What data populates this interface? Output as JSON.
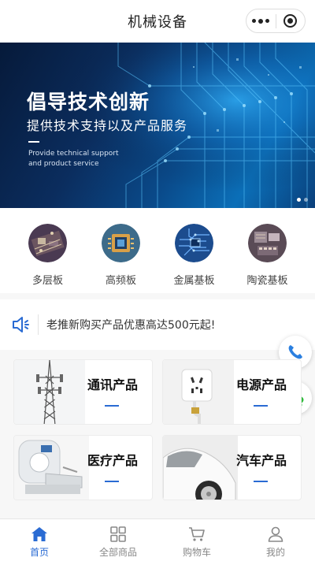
{
  "header": {
    "title": "机械设备",
    "more_icon": "more-dots-icon",
    "close_icon": "target-close-icon"
  },
  "banner": {
    "headline": "倡导技术创新",
    "subheadline": "提供技术支持以及产品服务",
    "english_line1": "Provide technical support",
    "english_line2": "and product service",
    "slide_count": 2,
    "active_slide": 1
  },
  "categories": [
    {
      "label": "多层板",
      "icon": "pcb-multilayer-icon"
    },
    {
      "label": "高频板",
      "icon": "pcb-chip-icon"
    },
    {
      "label": "金属基板",
      "icon": "pcb-metal-icon"
    },
    {
      "label": "陶瓷基板",
      "icon": "pcb-ceramic-icon"
    }
  ],
  "notice": {
    "icon": "speaker-icon",
    "text": "老推新购买产品优惠高达500元起!"
  },
  "floating": {
    "phone_icon": "phone-icon",
    "wechat_icon": "wechat-icon"
  },
  "products": [
    {
      "name": "通讯产品"
    },
    {
      "name": "电源产品"
    },
    {
      "name": "医疗产品"
    },
    {
      "name": "汽车产品"
    }
  ],
  "tabbar": {
    "items": [
      {
        "label": "首页",
        "icon": "home-icon",
        "active": true
      },
      {
        "label": "全部商品",
        "icon": "grid-icon",
        "active": false
      },
      {
        "label": "购物车",
        "icon": "cart-icon",
        "active": false
      },
      {
        "label": "我的",
        "icon": "user-icon",
        "active": false
      }
    ]
  },
  "colors": {
    "accent": "#2a6bd3",
    "banner_dark": "#061a3a"
  }
}
